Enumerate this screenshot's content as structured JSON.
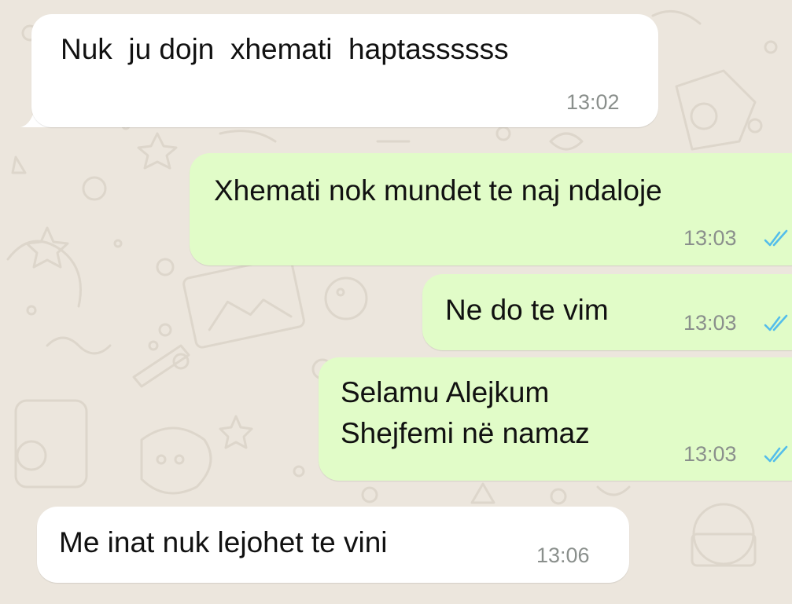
{
  "chat": {
    "messages": [
      {
        "direction": "incoming",
        "text": "Nuk  ju dojn  xhemati  haptassssss",
        "time": "13:02"
      },
      {
        "direction": "outgoing",
        "text": "Xhemati nok mundet te naj ndaloje",
        "time": "13:03",
        "status": "read"
      },
      {
        "direction": "outgoing",
        "text": "Ne do te vim",
        "time": "13:03",
        "status": "read"
      },
      {
        "direction": "outgoing",
        "text": "Selamu Alejkum\nShejfemi në namaz",
        "time": "13:03",
        "status": "read"
      },
      {
        "direction": "incoming",
        "text": "Me inat nuk lejohet te vini",
        "time": "13:06"
      }
    ]
  },
  "colors": {
    "wallpaper": "#ece6dd",
    "incoming_bubble": "#ffffff",
    "outgoing_bubble": "#e1fcc8",
    "timestamp": "#8a8f8c",
    "read_ticks": "#53bdeb"
  },
  "icons": {
    "read_status": "double-check-icon"
  }
}
